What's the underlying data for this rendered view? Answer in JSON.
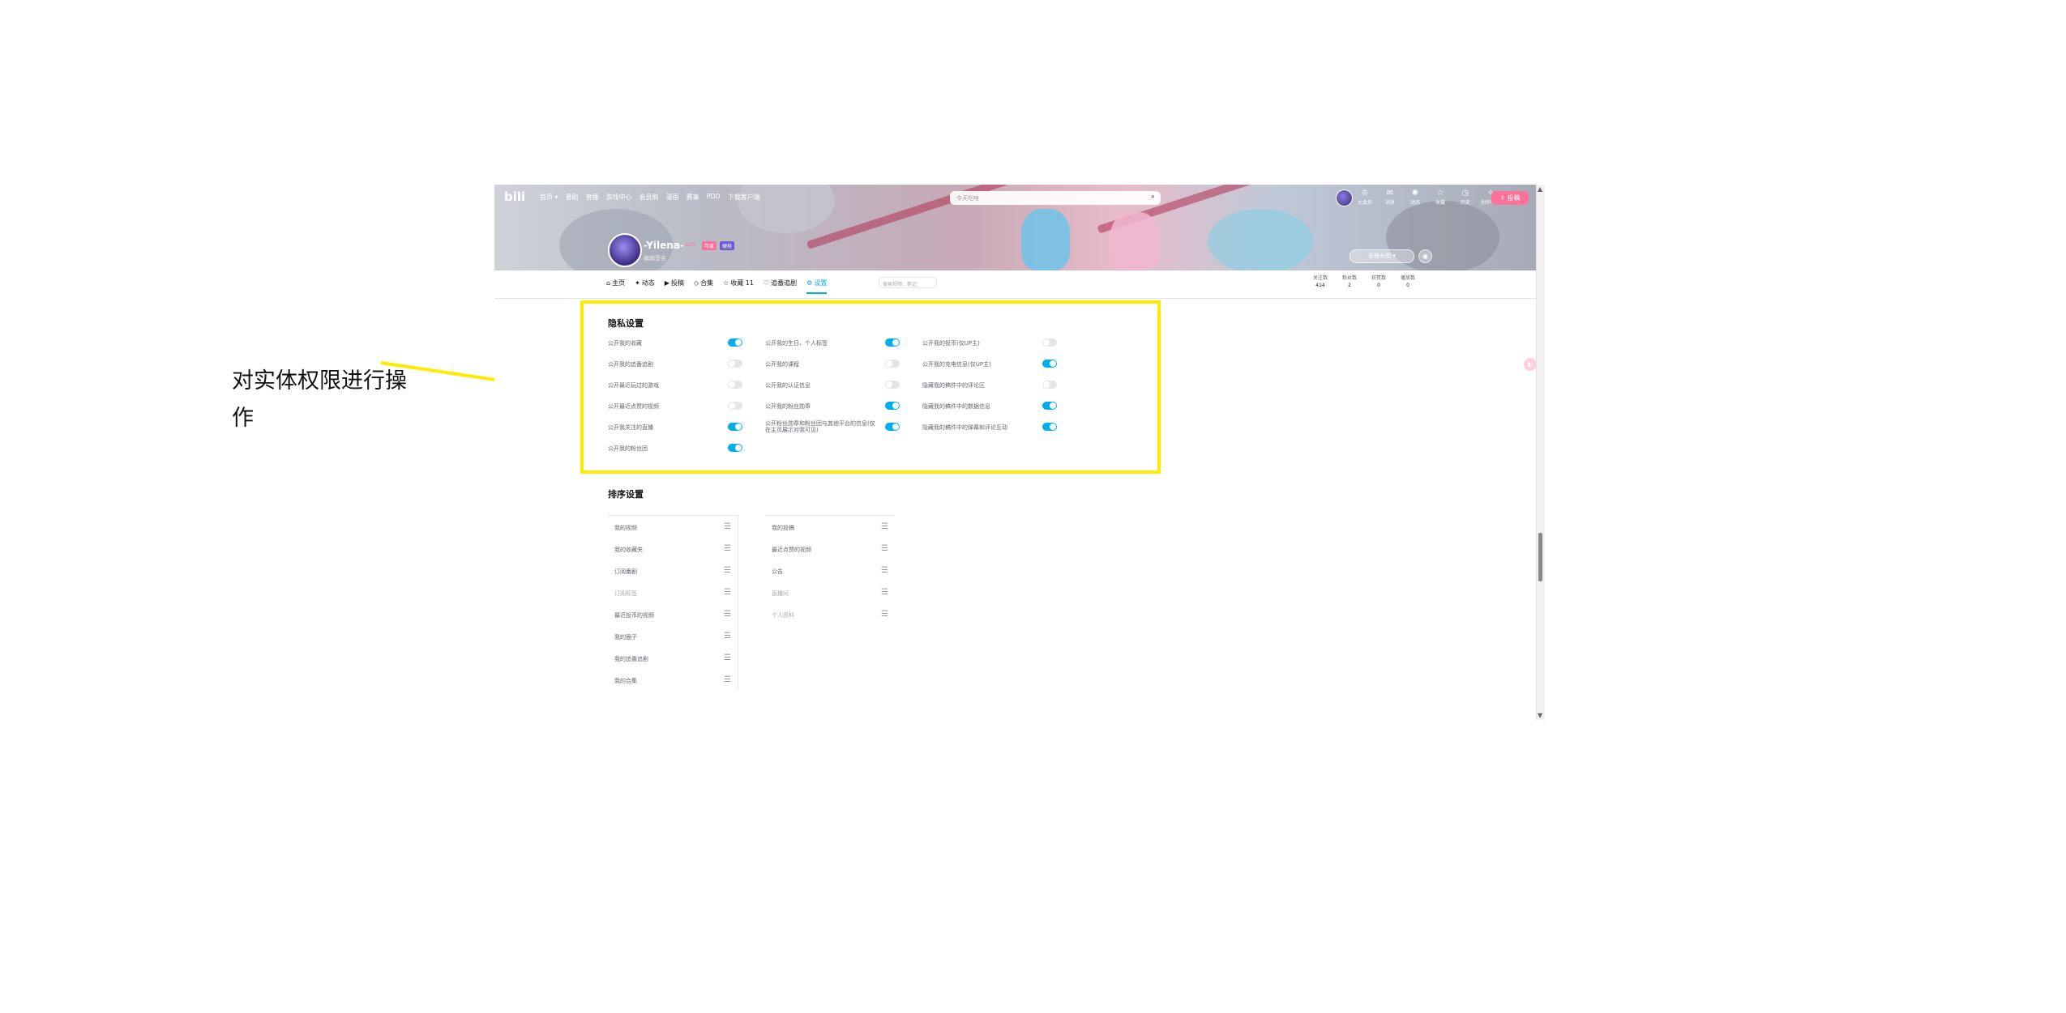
{
  "annotation": {
    "text": "对实体权限进行操作",
    "color": "#ffeb00"
  },
  "topnav": {
    "logo": "bili",
    "items": [
      "首页 ▾",
      "番剧",
      "直播",
      "游戏中心",
      "会员购",
      "漫画",
      "赛事",
      "PDD",
      "下载客户端"
    ],
    "search_placeholder": "今天吃啥",
    "right_items": [
      {
        "icon": "crown-icon",
        "label": "大会员"
      },
      {
        "icon": "message-icon",
        "label": "消息"
      },
      {
        "icon": "dynamic-icon",
        "label": "动态"
      },
      {
        "icon": "star-icon",
        "label": "收藏"
      },
      {
        "icon": "history-icon",
        "label": "历史"
      },
      {
        "icon": "bulb-icon",
        "label": "创作中心"
      }
    ],
    "post_label": "投稿"
  },
  "profile": {
    "username": "-Yilena-",
    "level": "LV5",
    "tag1": "年度",
    "tag2": "硬核",
    "sign": "编辑签名",
    "pill": "更换头图 ▾"
  },
  "tabs": [
    {
      "icon": "⌂",
      "label": "主页"
    },
    {
      "icon": "✦",
      "label": "动态"
    },
    {
      "icon": "▶",
      "label": "投稿"
    },
    {
      "icon": "◇",
      "label": "合集"
    },
    {
      "icon": "☆",
      "label": "收藏 11"
    },
    {
      "icon": "♡",
      "label": "追番追剧"
    },
    {
      "icon": "⚙",
      "label": "设置"
    }
  ],
  "tab_search_placeholder": "搜索视频、笔记",
  "stats": [
    {
      "label": "关注数",
      "value": "414"
    },
    {
      "label": "粉丝数",
      "value": "2"
    },
    {
      "label": "获赞数",
      "value": "0"
    },
    {
      "label": "播放数",
      "value": "0"
    }
  ],
  "privacy": {
    "title": "隐私设置",
    "rows": [
      {
        "label": "公开我的收藏",
        "on": true
      },
      {
        "label": "公开我的追番追剧",
        "on": false
      },
      {
        "label": "公开最近玩过的游戏",
        "on": false
      },
      {
        "label": "公开最近点赞的视频",
        "on": false
      },
      {
        "label": "公开我关注的直播",
        "on": true
      },
      {
        "label": "公开我的粉丝团",
        "on": true
      },
      {
        "label": "公开我的生日、个人标签",
        "on": true
      },
      {
        "label": "公开我的课程",
        "on": false
      },
      {
        "label": "公开我的认证信息",
        "on": false
      },
      {
        "label": "公开我的粉丝勋章",
        "on": true
      },
      {
        "label": "公开粉丝勋章和粉丝团与其他平台的信息(仅在主页展示对我可见)",
        "on": true
      },
      {
        "label": "公开我的投币(仅UP主)",
        "on": false
      },
      {
        "label": "公开我的充电信息(仅UP主)",
        "on": true
      },
      {
        "label": "隐藏我的稿件中的评论区",
        "on": false
      },
      {
        "label": "隐藏我的稿件中的数据信息",
        "on": true
      },
      {
        "label": "隐藏我的稿件中的弹幕和评论互动",
        "on": true
      }
    ]
  },
  "sorting": {
    "title": "排序设置",
    "left": [
      "我的视频",
      "我的收藏夹",
      "订阅番剧",
      "订阅标签",
      "最近投币的视频",
      "我的圈子",
      "我的追番追剧",
      "我的合集"
    ],
    "right": [
      "我的投稿",
      "最近点赞的视频",
      "公告",
      "直播间",
      "个人资料"
    ]
  },
  "colors": {
    "accent": "#00aeec",
    "pink": "#fb7299",
    "switch_off": "#e3e5e7"
  }
}
